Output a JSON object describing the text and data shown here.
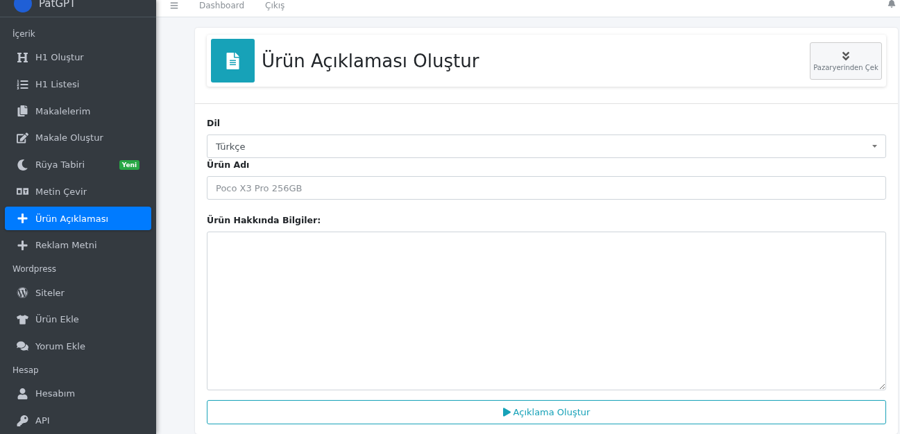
{
  "sidebar": {
    "brand": "PatGPT",
    "sections": [
      {
        "header": "İçerik",
        "items": [
          {
            "label": "H1 Oluştur",
            "selected": false
          },
          {
            "label": "H1 Listesi",
            "selected": false
          },
          {
            "label": "Makalelerim",
            "selected": false
          },
          {
            "label": "Makale Oluştur",
            "selected": false
          },
          {
            "label": "Rüya Tabiri",
            "selected": false,
            "badge": "Yeni"
          },
          {
            "label": "Metin Çevir",
            "selected": false
          },
          {
            "label": "Ürün Açıklaması",
            "selected": true
          },
          {
            "label": "Reklam Metni",
            "selected": false
          }
        ]
      },
      {
        "header": "Wordpress",
        "items": [
          {
            "label": "Siteler",
            "selected": false
          },
          {
            "label": "Ürün Ekle",
            "selected": false
          },
          {
            "label": "Yorum Ekle",
            "selected": false
          }
        ]
      },
      {
        "header": "Hesap",
        "items": [
          {
            "label": "Hesabım",
            "selected": false
          },
          {
            "label": "API",
            "selected": false
          }
        ]
      }
    ]
  },
  "navbar": {
    "links": [
      "Dashboard",
      "Çıkış"
    ]
  },
  "page": {
    "title": "Ürün Açıklaması Oluştur",
    "fetch_button": "Pazaryerinden Çek",
    "form": {
      "language": {
        "label": "Dil",
        "value": "Türkçe"
      },
      "product_name": {
        "label": "Ürün Adı",
        "placeholder": "Poco X3 Pro 256GB"
      },
      "info": {
        "label": "Ürün Hakkında Bilgiler:"
      },
      "submit": "Açıklama Oluştur"
    }
  }
}
